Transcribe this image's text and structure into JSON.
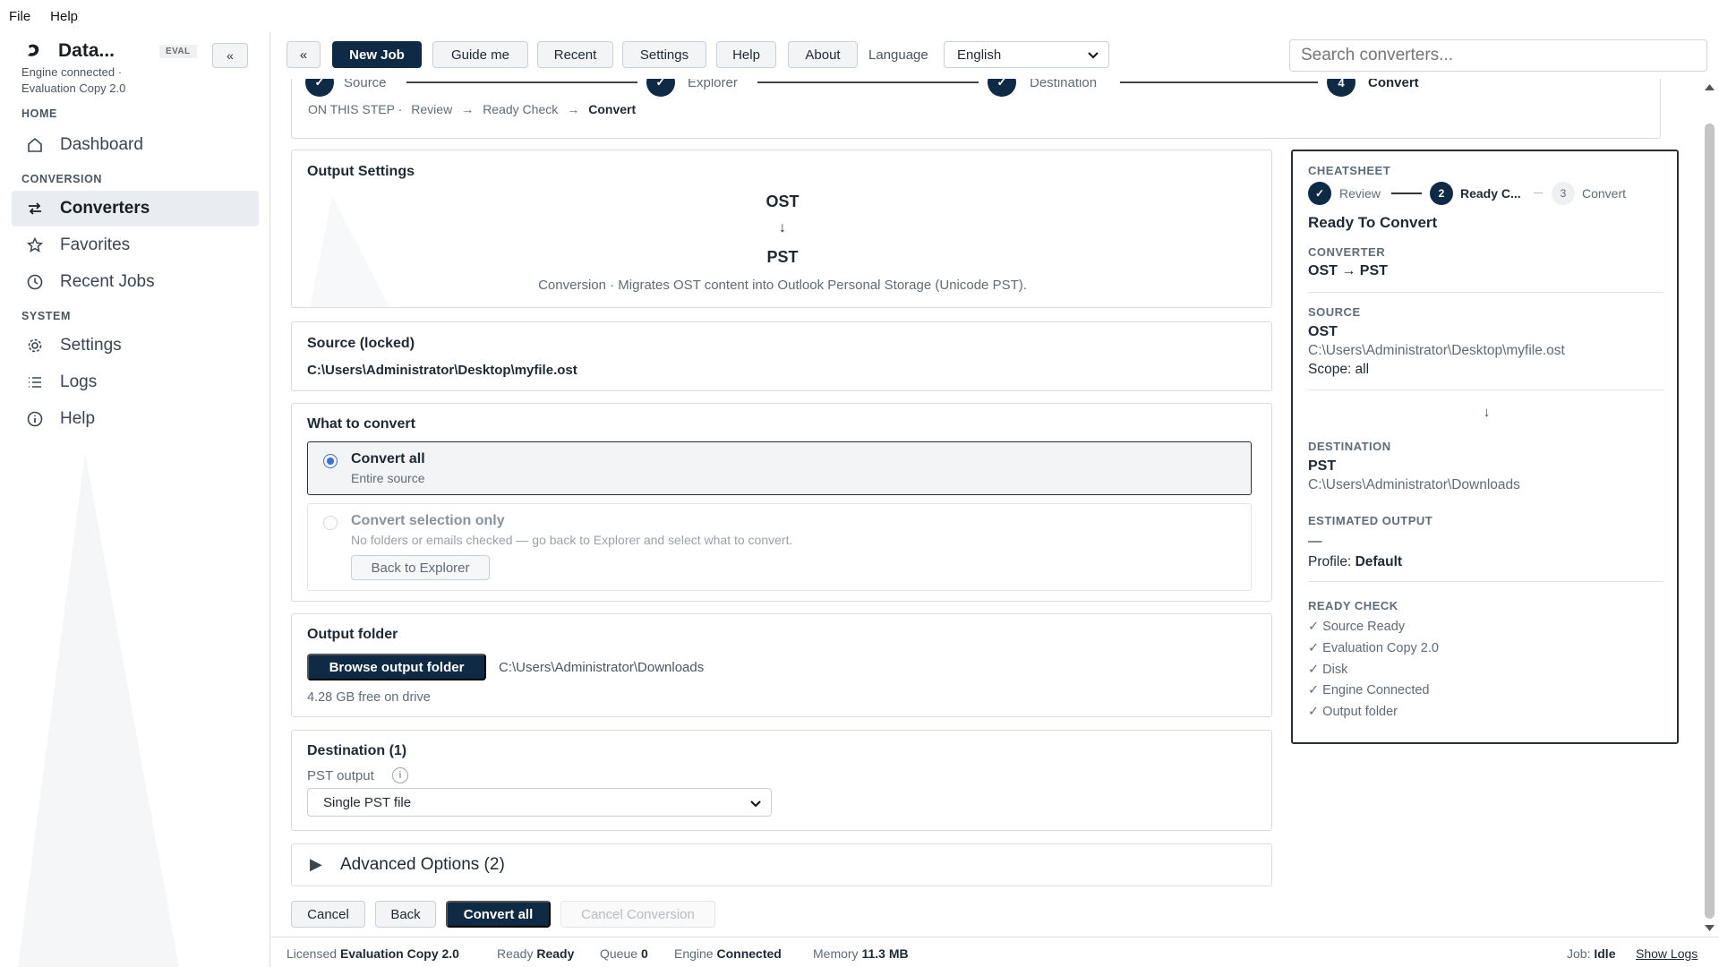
{
  "menubar": {
    "items": [
      "File",
      "Help"
    ]
  },
  "sidebar": {
    "app_name": "Data...",
    "badge": "EVAL",
    "collapse_label": "«",
    "engine_status": "Engine connected · Evaluation Copy 2.0",
    "sections": {
      "home": "HOME",
      "conversion": "CONVERSION",
      "system": "SYSTEM"
    },
    "items": {
      "dashboard": "Dashboard",
      "converters": "Converters",
      "favorites": "Favorites",
      "recent_jobs": "Recent Jobs",
      "settings": "Settings",
      "logs": "Logs",
      "help": "Help"
    }
  },
  "toolbar": {
    "back": "«",
    "new_job": "New Job",
    "guide_me": "Guide me",
    "recent": "Recent",
    "settings": "Settings",
    "help": "Help",
    "about": "About",
    "language_label": "Language",
    "language_value": "English",
    "search_placeholder": "Search converters..."
  },
  "stepper": {
    "steps": [
      {
        "num": "✓",
        "label": "Source"
      },
      {
        "num": "✓",
        "label": "Explorer"
      },
      {
        "num": "✓",
        "label": "Destination"
      },
      {
        "num": "4",
        "label": "Convert"
      }
    ],
    "on_this_step": "ON THIS STEP  ·",
    "breadcrumb": [
      "Review",
      "→",
      "Ready Check",
      "→",
      "Convert"
    ]
  },
  "output_settings": {
    "title": "Output Settings",
    "from": "OST",
    "arrow": "↓",
    "to": "PST",
    "description": "Conversion · Migrates OST content into Outlook Personal Storage (Unicode PST)."
  },
  "source": {
    "title": "Source (locked)",
    "path": "C:\\Users\\Administrator\\Desktop\\myfile.ost"
  },
  "what_to_convert": {
    "title": "What to convert",
    "option_all_title": "Convert all",
    "option_all_sub": "Entire source",
    "option_sel_title": "Convert selection only",
    "option_sel_sub": "No folders or emails checked — go back to Explorer and select what to convert.",
    "back_to_explorer": "Back to Explorer"
  },
  "output_folder": {
    "title": "Output folder",
    "browse": "Browse output folder",
    "path": "C:\\Users\\Administrator\\Downloads",
    "free_space": "4.28 GB free on drive"
  },
  "destination": {
    "title": "Destination (1)",
    "pst_output_label": "PST output",
    "info_icon": "i",
    "pst_output_value": "Single PST file"
  },
  "advanced": {
    "arrow": "▶",
    "title": "Advanced Options (2)"
  },
  "actions": {
    "cancel": "Cancel",
    "back": "Back",
    "convert_all": "Convert all",
    "cancel_conversion": "Cancel Conversion"
  },
  "cheatsheet": {
    "label": "CHEATSHEET",
    "steps": [
      {
        "num": "✓",
        "label": "Review"
      },
      {
        "num": "2",
        "label": "Ready C..."
      },
      {
        "num": "3",
        "label": "Convert"
      }
    ],
    "heading": "Ready To Convert",
    "converter_label": "CONVERTER",
    "converter_value": "OST → PST",
    "source_label": "SOURCE",
    "source_format": "OST",
    "source_path": "C:\\Users\\Administrator\\Desktop\\myfile.ost",
    "scope": "Scope: all",
    "down_arrow": "↓",
    "destination_label": "DESTINATION",
    "destination_format": "PST",
    "destination_path": "C:\\Users\\Administrator\\Downloads",
    "estimated_label": "ESTIMATED OUTPUT",
    "estimated_value": "—",
    "profile_label": "Profile:",
    "profile_value": "Default",
    "ready_check_label": "READY CHECK",
    "checks": [
      "✓ Source Ready",
      "✓ Evaluation Copy 2.0",
      "✓ Disk",
      "✓ Engine Connected",
      "✓ Output folder"
    ]
  },
  "statusbar": {
    "licensed_label": "Licensed",
    "licensed_value": "Evaluation Copy 2.0",
    "ready_label": "Ready",
    "ready_value": "Ready",
    "queue_label": "Queue",
    "queue_value": "0",
    "engine_label": "Engine",
    "engine_value": "Connected",
    "memory_label": "Memory",
    "memory_value": "11.3 MB",
    "job_label": "Job:",
    "job_value": "Idle",
    "show_logs": "Show Logs"
  },
  "colors": {
    "primary": "#0f2a44",
    "radio": "#3c6fd6",
    "sidebar_active": "#e9ecf0"
  }
}
